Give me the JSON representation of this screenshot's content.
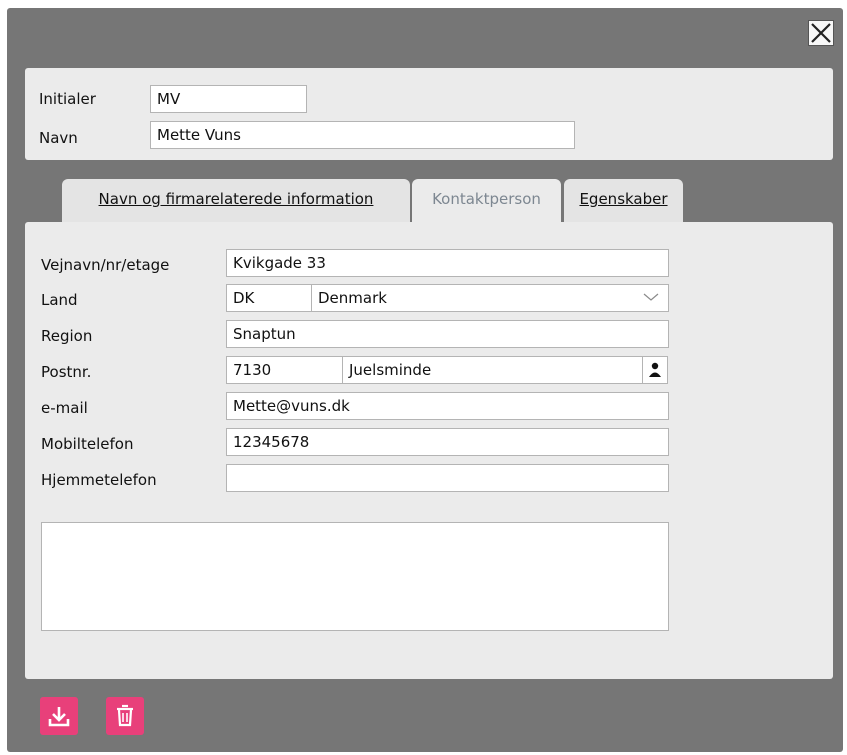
{
  "header": {
    "initials_label": "Initialer",
    "initials_value": "MV",
    "name_label": "Navn",
    "name_value": "Mette Vuns"
  },
  "tabs": [
    {
      "label": "Navn og firmarelaterede information",
      "active": false
    },
    {
      "label": "Kontaktperson",
      "active": true
    },
    {
      "label": "Egenskaber",
      "active": false
    }
  ],
  "contact": {
    "street_label": "Vejnavn/nr/etage",
    "street_value": "Kvikgade 33",
    "country_label": "Land",
    "country_code": "DK",
    "country_name": "Denmark",
    "region_label": "Region",
    "region_value": "Snaptun",
    "postal_label": "Postnr.",
    "postal_code": "7130",
    "city": "Juelsminde",
    "email_label": "e-mail",
    "email_value": "Mette@vuns.dk",
    "mobile_label": "Mobiltelefon",
    "mobile_value": "12345678",
    "home_phone_label": "Hjemmetelefon",
    "home_phone_value": "",
    "notes_value": ""
  },
  "icons": {
    "close": "close-icon",
    "lookup": "person-lookup-icon",
    "save": "download-icon",
    "delete": "trash-icon"
  },
  "colors": {
    "accent": "#e8407a",
    "frame": "#767676",
    "panel": "#ebebeb",
    "active_tab_text": "#7d8791"
  }
}
